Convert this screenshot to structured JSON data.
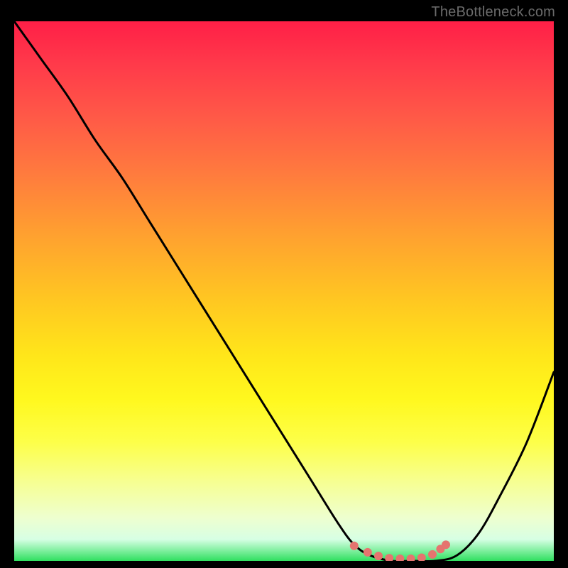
{
  "watermark": "TheBottleneck.com",
  "chart_data": {
    "type": "line",
    "title": "",
    "xlabel": "",
    "ylabel": "",
    "xlim": [
      0,
      100
    ],
    "ylim": [
      0,
      100
    ],
    "x": [
      0,
      5,
      10,
      15,
      20,
      25,
      30,
      35,
      40,
      45,
      50,
      55,
      60,
      63,
      66,
      70,
      74,
      78,
      82,
      86,
      90,
      95,
      100
    ],
    "y": [
      100,
      93,
      86,
      78,
      71,
      63,
      55,
      47,
      39,
      31,
      23,
      15,
      7,
      3,
      1,
      0,
      0,
      0,
      1,
      5,
      12,
      22,
      35
    ],
    "valley_markers": {
      "color": "#e5746f",
      "x": [
        63.0,
        65.5,
        67.5,
        69.5,
        71.5,
        73.5,
        75.5,
        77.5,
        79.0,
        80.0
      ],
      "y": [
        2.8,
        1.6,
        0.9,
        0.5,
        0.4,
        0.4,
        0.6,
        1.2,
        2.2,
        3.0
      ]
    }
  },
  "colors": {
    "curve": "#000000",
    "marker": "#e5746f"
  }
}
